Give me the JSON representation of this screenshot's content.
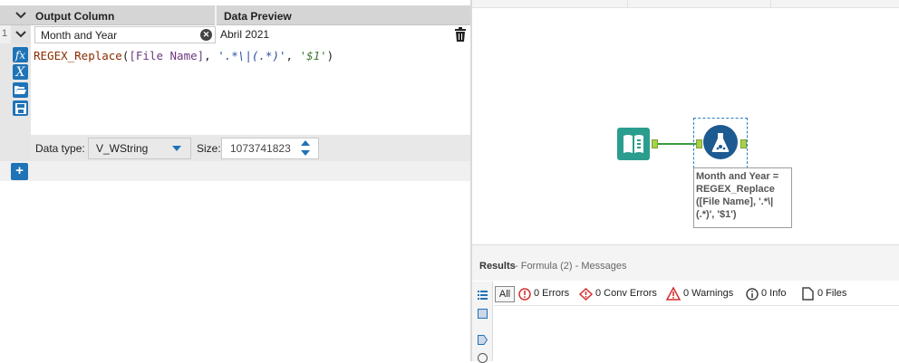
{
  "formula_editor": {
    "header": {
      "output_column": "Output Column",
      "data_preview": "Data Preview"
    },
    "row": {
      "number": "1",
      "output_column": "Month and Year",
      "preview": "Abril 2021",
      "formula": {
        "func": "REGEX_Replace",
        "open": "(",
        "field": "[File Name]",
        "comma1": ", ",
        "pattern": "'.*\\|(.*)'",
        "comma2": ", ",
        "replacement": "'$1'",
        "close": ")"
      },
      "data_type_label": "Data type:",
      "data_type": "V_WString",
      "size_label": "Size:",
      "size": "1073741823"
    },
    "tool_icons": [
      "fx-icon",
      "variable-icon",
      "open-folder-icon",
      "save-icon"
    ],
    "add_label": "+"
  },
  "canvas": {
    "annotation": "Month and Year = REGEX_Replace ([File Name], '.*\\|(.*)', '$1')",
    "annotation_lines": [
      "Month and Year =",
      "REGEX_Replace",
      "([File Name], '.*\\|",
      "(.*)', '$1')"
    ]
  },
  "results": {
    "title": "Results",
    "subtitle": "- Formula (2) - Messages",
    "filters": {
      "all": "All",
      "errors": "0 Errors",
      "conv_errors": "0 Conv Errors",
      "warnings": "0 Warnings",
      "info": "0 Info",
      "files": "0 Files"
    }
  },
  "colors": {
    "accent": "#1f73b7",
    "anchor": "#a8d04a",
    "connection": "#3c9b3c",
    "input_tool": "#2a9d8f",
    "formula_tool": "#1c5a91",
    "error": "#d32f2f"
  }
}
